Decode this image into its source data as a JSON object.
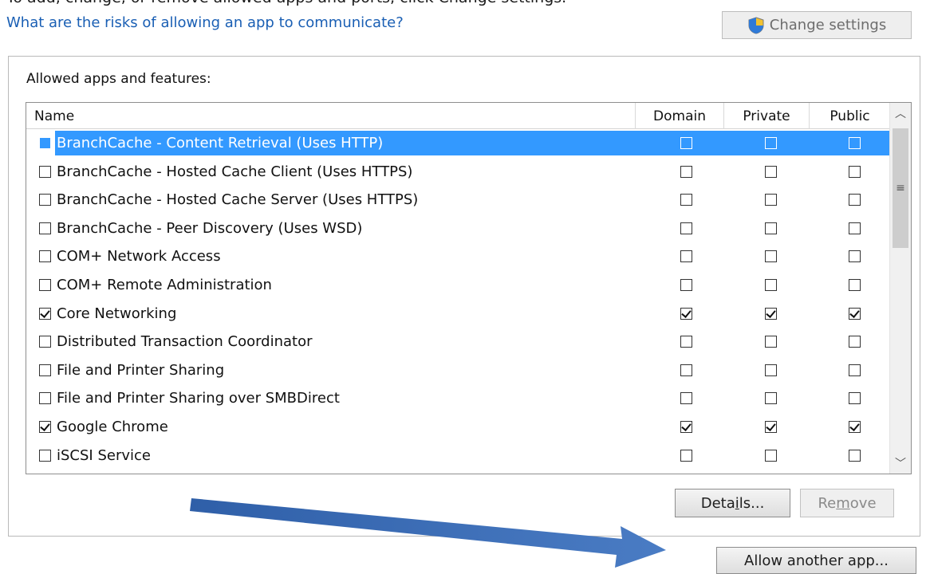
{
  "top_partial_text": "To add, change, or remove allowed apps and ports, click Change settings.",
  "risk_link": "What are the risks of allowing an app to communicate?",
  "change_settings_label": "Change settings",
  "group_label": "Allowed apps and features:",
  "columns": {
    "name": "Name",
    "domain": "Domain",
    "private": "Private",
    "public": "Public"
  },
  "rows": [
    {
      "name": "BranchCache - Content Retrieval (Uses HTTP)",
      "enabled": false,
      "domain": false,
      "private": false,
      "public": false,
      "selected": true
    },
    {
      "name": "BranchCache - Hosted Cache Client (Uses HTTPS)",
      "enabled": false,
      "domain": false,
      "private": false,
      "public": false
    },
    {
      "name": "BranchCache - Hosted Cache Server (Uses HTTPS)",
      "enabled": false,
      "domain": false,
      "private": false,
      "public": false
    },
    {
      "name": "BranchCache - Peer Discovery (Uses WSD)",
      "enabled": false,
      "domain": false,
      "private": false,
      "public": false
    },
    {
      "name": "COM+ Network Access",
      "enabled": false,
      "domain": false,
      "private": false,
      "public": false
    },
    {
      "name": "COM+ Remote Administration",
      "enabled": false,
      "domain": false,
      "private": false,
      "public": false
    },
    {
      "name": "Core Networking",
      "enabled": true,
      "domain": true,
      "private": true,
      "public": true
    },
    {
      "name": "Distributed Transaction Coordinator",
      "enabled": false,
      "domain": false,
      "private": false,
      "public": false
    },
    {
      "name": "File and Printer Sharing",
      "enabled": false,
      "domain": false,
      "private": false,
      "public": false
    },
    {
      "name": "File and Printer Sharing over SMBDirect",
      "enabled": false,
      "domain": false,
      "private": false,
      "public": false
    },
    {
      "name": "Google Chrome",
      "enabled": true,
      "domain": true,
      "private": true,
      "public": true
    },
    {
      "name": "iSCSI Service",
      "enabled": false,
      "domain": false,
      "private": false,
      "public": false
    }
  ],
  "buttons": {
    "details_pre": "Deta",
    "details_key": "i",
    "details_post": "ls...",
    "remove_pre": "Re",
    "remove_key": "m",
    "remove_post": "ove",
    "allow_another": "Allow another app..."
  },
  "colors": {
    "selection": "#3399ff",
    "link": "#1a5fb4",
    "annotation_arrow": "#3f6fb6"
  }
}
